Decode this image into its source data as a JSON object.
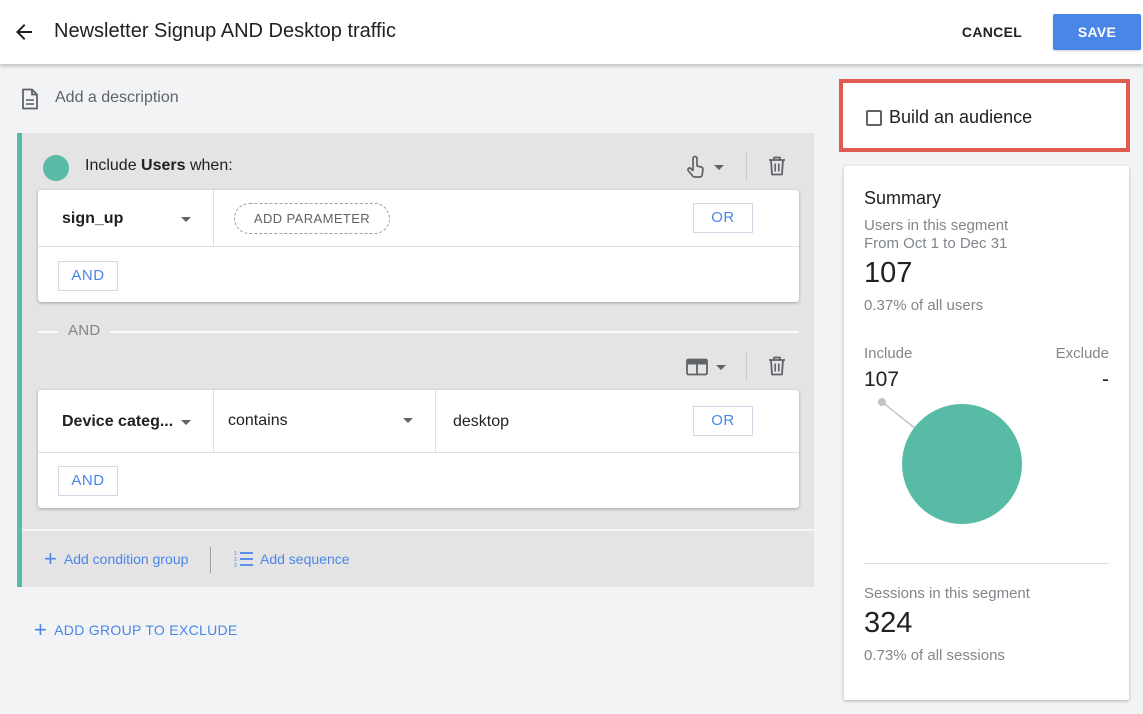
{
  "header": {
    "title": "Newsletter Signup AND Desktop traffic",
    "cancel_label": "CANCEL",
    "save_label": "SAVE"
  },
  "description": {
    "placeholder": "Add a description"
  },
  "include_group": {
    "label_prefix": "Include ",
    "label_scope": "Users",
    "label_suffix": " when:",
    "condition_1": {
      "dimension": "sign_up",
      "add_parameter_label": "ADD PARAMETER",
      "or_label": "OR",
      "and_label": "AND"
    },
    "and_divider_label": "AND",
    "condition_2": {
      "dimension": "Device categ...",
      "operator": "contains",
      "value": "desktop",
      "or_label": "OR",
      "and_label": "AND"
    },
    "add_condition_group_label": "Add condition group",
    "add_sequence_label": "Add sequence"
  },
  "add_group_to_exclude_label": "ADD GROUP TO EXCLUDE",
  "audience": {
    "label": "Build an audience",
    "checked": false
  },
  "summary": {
    "title": "Summary",
    "users_label": "Users in this segment",
    "date_range": "From Oct 1 to Dec 31",
    "users_count": "107",
    "users_pct": "0.37% of all users",
    "include_label": "Include",
    "exclude_label": "Exclude",
    "include_value": "107",
    "exclude_value": "-",
    "sessions_label": "Sessions in this segment",
    "sessions_count": "324",
    "sessions_pct": "0.73% of all sessions"
  },
  "colors": {
    "accent": "#4a86e8",
    "segment_green": "#57bba6",
    "highlight_red": "#e05a50"
  },
  "icons": {
    "back": "arrow-left-icon",
    "description": "document-icon",
    "scope": "touch-hand-icon",
    "scope2": "session-card-icon",
    "delete": "trash-icon",
    "add": "plus-icon",
    "sequence": "numbered-list-icon"
  }
}
